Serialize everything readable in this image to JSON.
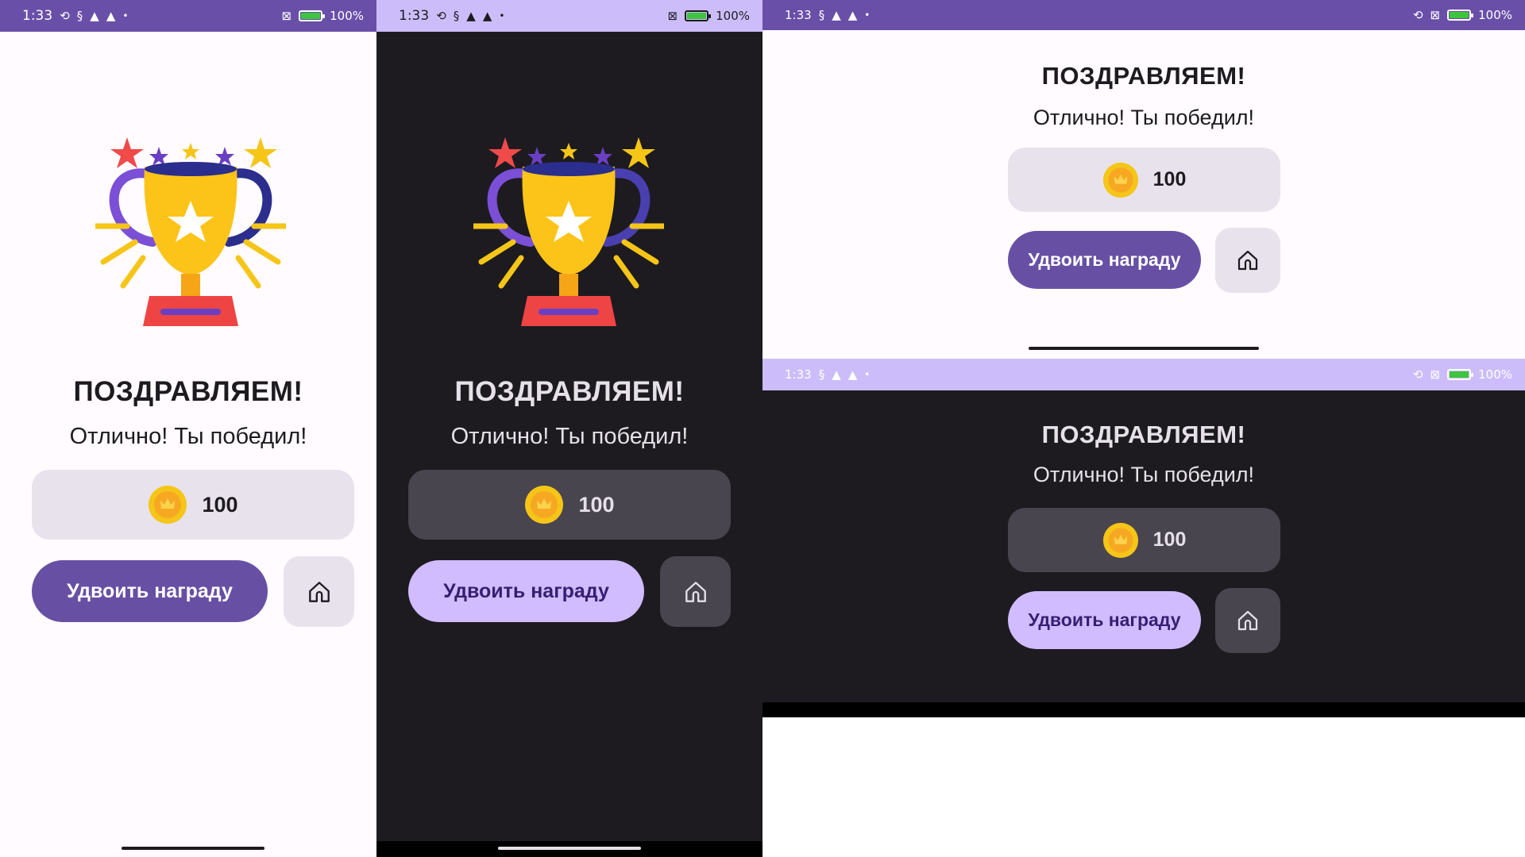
{
  "status": {
    "time": "1:33",
    "battery_pct": "100%",
    "battery_level": 1.0
  },
  "screen": {
    "title": "ПОЗДРАВЛЯЕМ!",
    "subtitle": "Отлично! Ты победил!",
    "reward_amount": "100",
    "double_label": "Удвоить награду"
  },
  "colors": {
    "status_bar_light": "#6a4fa8",
    "status_bar_dark": "#ccbdfa",
    "bg_light": "#fffbff",
    "bg_dark": "#1d1b20",
    "reward_box_light": "#e8e2ec",
    "reward_box_dark": "#49454f",
    "button_light": "#6750a4",
    "button_dark": "#d0bcff",
    "button_text_dark": "#381e72",
    "coin": "#f5c518"
  },
  "icons": [
    "home-icon",
    "coin-icon",
    "trophy-icon",
    "battery-icon",
    "warning-icon",
    "sync-off-icon"
  ]
}
